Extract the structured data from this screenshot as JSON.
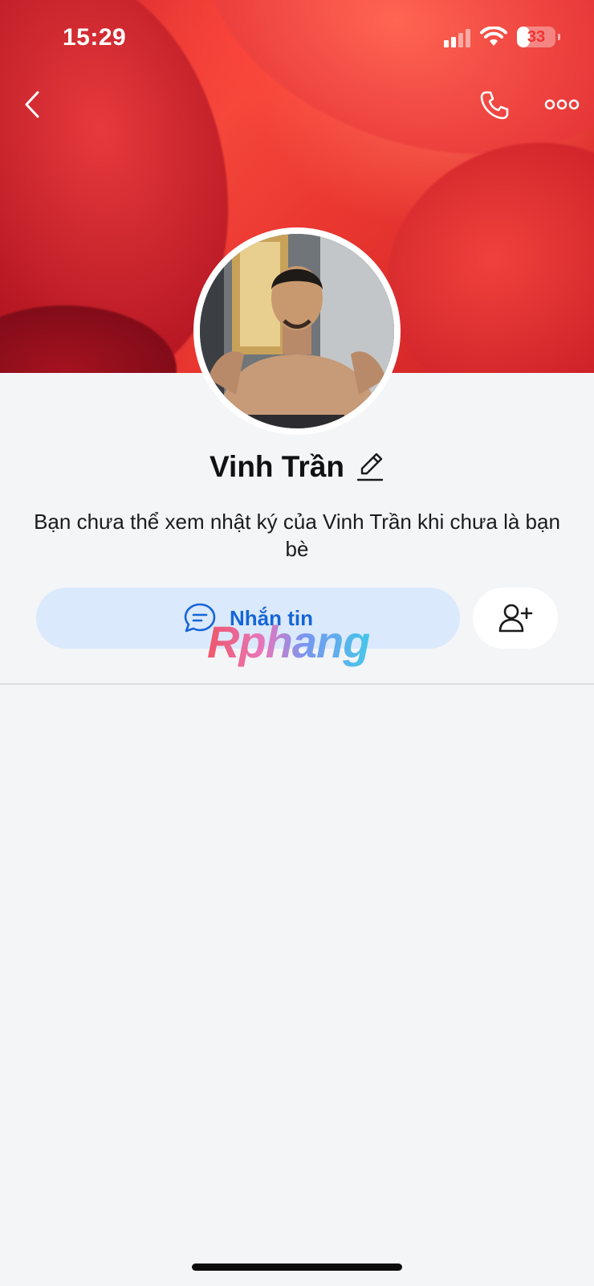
{
  "status_bar": {
    "time": "15:29",
    "battery": "33",
    "battery_level": 0.33,
    "signal_icon": "signal-bars-icon",
    "wifi_icon": "wifi-icon"
  },
  "header": {
    "back_icon": "chevron-left-icon",
    "call_icon": "phone-icon",
    "more_icon": "more-dots-icon"
  },
  "profile": {
    "name": "Vinh Trần",
    "edit_icon": "pencil-icon",
    "notice": "Bạn chưa thể xem nhật ký của Vinh Trần khi chưa là bạn bè"
  },
  "actions": {
    "message_label": "Nhắn tin",
    "message_icon": "chat-bubble-icon",
    "add_friend_icon": "add-user-icon"
  },
  "watermark": {
    "text": "Rphang"
  },
  "colors": {
    "accent": "#1566d6",
    "message_button_bg": "#dbe9fd",
    "page_bg": "#f4f5f7"
  }
}
